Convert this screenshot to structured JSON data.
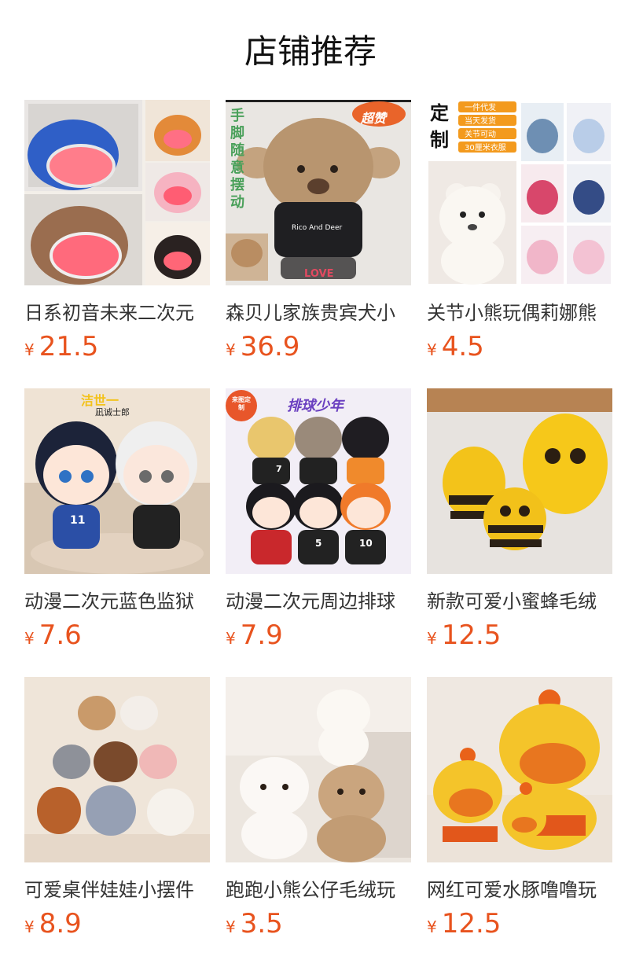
{
  "page_title": "店铺推荐",
  "currency_symbol": "¥",
  "colors": {
    "price": "#e8531e",
    "text": "#333333",
    "title": "#111111"
  },
  "products": [
    {
      "name": "日系初音未来二次元",
      "price": "21.5",
      "image_icon": "anime-plush-backpack-image",
      "image_text": []
    },
    {
      "name": "森贝儿家族贵宾犬小",
      "price": "36.9",
      "image_icon": "poodle-plush-image",
      "image_text": [
        "手",
        "脚",
        "随",
        "意",
        "摆",
        "动",
        "超赞",
        "Rico And Deer",
        "LOVE"
      ]
    },
    {
      "name": "关节小熊玩偶莉娜熊",
      "price": "4.5",
      "image_icon": "bear-doll-image",
      "image_text": [
        "定",
        "制",
        "一件代发",
        "当天发货",
        "关节可动",
        "30厘米衣服"
      ]
    },
    {
      "name": "动漫二次元蓝色监狱",
      "price": "7.6",
      "image_icon": "anime-boys-plush-image",
      "image_text": [
        "洁世一",
        "凪诚士郎",
        "11"
      ]
    },
    {
      "name": "动漫二次元周边排球",
      "price": "7.9",
      "image_icon": "volleyball-anime-plush-image",
      "image_text": [
        "来图定制",
        "排球少年",
        "7",
        "5",
        "10"
      ]
    },
    {
      "name": "新款可爱小蜜蜂毛绒",
      "price": "12.5",
      "image_icon": "bee-plush-image",
      "image_text": []
    },
    {
      "name": "可爱桌伴娃娃小摆件",
      "price": "8.9",
      "image_icon": "animal-plush-group-image",
      "image_text": []
    },
    {
      "name": "跑跑小熊公仔毛绒玩",
      "price": "3.5",
      "image_icon": "bear-and-cat-plush-image",
      "image_text": []
    },
    {
      "name": "网红可爱水豚噜噜玩",
      "price": "12.5",
      "image_icon": "capybara-plush-image",
      "image_text": []
    }
  ]
}
